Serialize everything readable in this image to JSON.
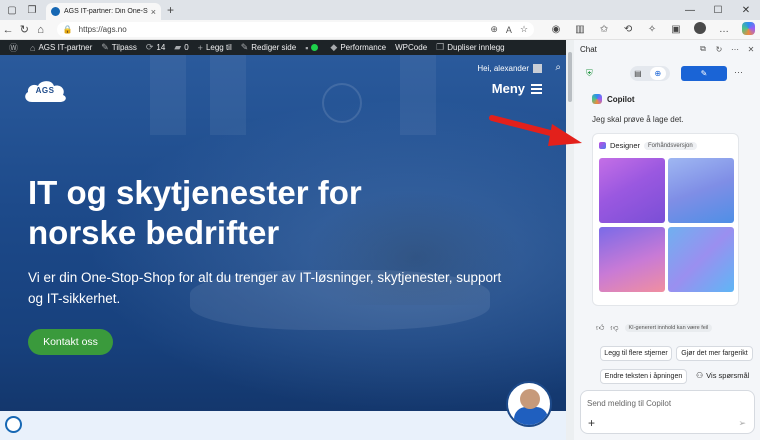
{
  "browser": {
    "tab_title": "AGS IT-partner: Din One-Stop-Sho",
    "tab_close": "×",
    "new_tab": "+",
    "url": "https://ags.no"
  },
  "wpbar": {
    "site_name": "AGS IT-partner",
    "customize": "Tilpass",
    "updates_count": "14",
    "comments_count": "0",
    "add_new": "Legg til",
    "edit_page": "Rediger side",
    "performance": "Performance",
    "wpcode": "WPCode",
    "duplicate": "Dupliser innlegg"
  },
  "site": {
    "greeting": "Hei, alexander",
    "logo": "AGS",
    "menu_label": "Meny",
    "hero_title": "IT og skytjenester for norske bedrifter",
    "hero_subtitle": "Vi er din One-Stop-Shop for alt du trenger av IT-løsninger, skytjenester, support og IT-sikkerhet.",
    "cta_label": "Kontakt oss"
  },
  "panel": {
    "title": "Chat",
    "copilot_name": "Copilot",
    "copilot_message": "Jeg skal prøve å lage det.",
    "designer_label": "Designer",
    "designer_badge": "Forhåndsversjon",
    "ai_note": "KI-generert innhold kan være feil",
    "suggestions": [
      "Legg til flere stjerner",
      "Gjør det mer fargerikt",
      "Endre teksten i åpningen"
    ],
    "vis_sporsmal": "Vis spørsmål",
    "input_placeholder": "Send melding til Copilot"
  },
  "colors": {
    "wp_bar": "#1d2327",
    "cta_green": "#3a9a3c",
    "copilot_blue": "#1a64d6",
    "annotation_red": "#e3201b"
  }
}
